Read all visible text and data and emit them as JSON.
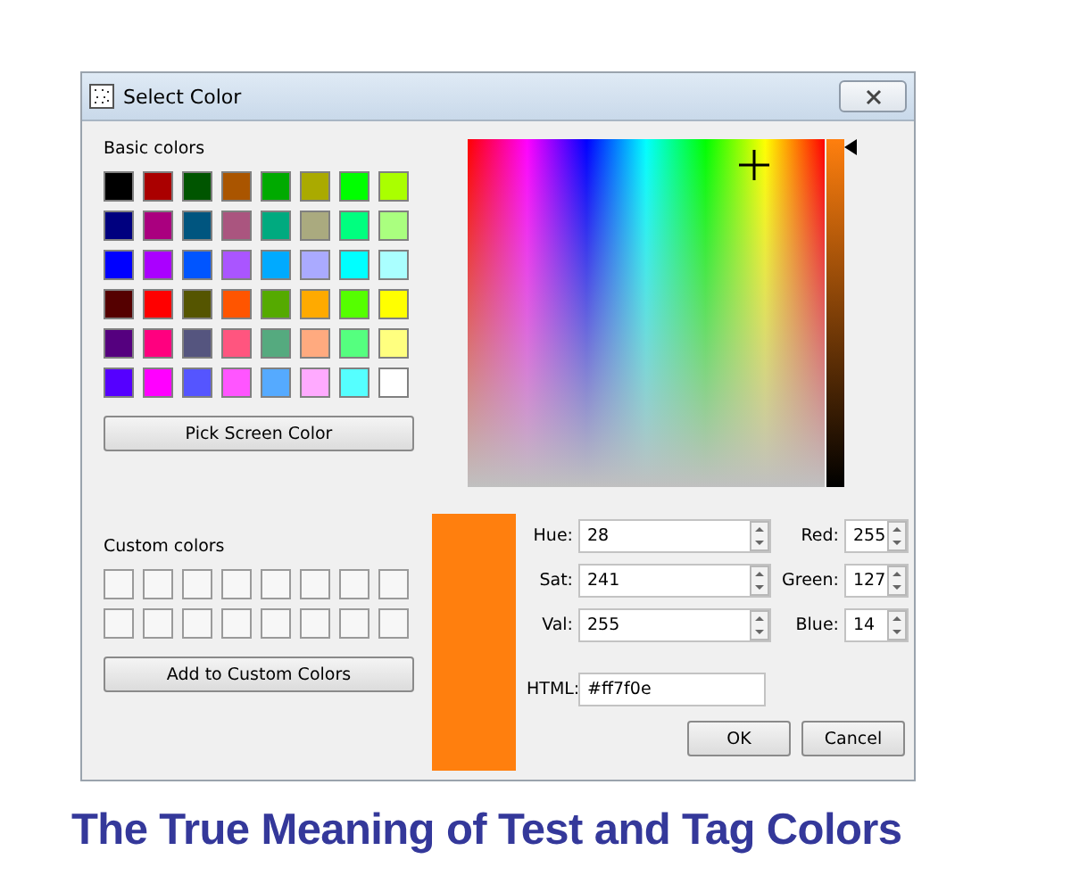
{
  "window": {
    "title": "Select Color"
  },
  "basic_colors": {
    "label": "Basic colors",
    "swatches": [
      {
        "color": "#000000"
      },
      {
        "color": "#aa0000"
      },
      {
        "color": "#005500"
      },
      {
        "color": "#aa5500"
      },
      {
        "color": "#00aa00"
      },
      {
        "color": "#aaaa00"
      },
      {
        "color": "#00ff00"
      },
      {
        "color": "#aaff00"
      },
      {
        "color": "#00007f"
      },
      {
        "color": "#aa007f"
      },
      {
        "color": "#00557f"
      },
      {
        "color": "#aa557f"
      },
      {
        "color": "#00aa7f"
      },
      {
        "color": "#aaaa7f"
      },
      {
        "color": "#00ff7f"
      },
      {
        "color": "#aaff7f"
      },
      {
        "color": "#0000ff"
      },
      {
        "color": "#aa00ff"
      },
      {
        "color": "#0055ff"
      },
      {
        "color": "#aa55ff"
      },
      {
        "color": "#00aaff"
      },
      {
        "color": "#aaaaff"
      },
      {
        "color": "#00ffff"
      },
      {
        "color": "#aaffff"
      },
      {
        "color": "#550000"
      },
      {
        "color": "#ff0000"
      },
      {
        "color": "#555500"
      },
      {
        "color": "#ff5500"
      },
      {
        "color": "#55aa00"
      },
      {
        "color": "#ffaa00"
      },
      {
        "color": "#55ff00"
      },
      {
        "color": "#ffff00"
      },
      {
        "color": "#55007f"
      },
      {
        "color": "#ff007f"
      },
      {
        "color": "#55557f"
      },
      {
        "color": "#ff557f"
      },
      {
        "color": "#55aa7f"
      },
      {
        "color": "#ffaa7f"
      },
      {
        "color": "#55ff7f"
      },
      {
        "color": "#ffff7f"
      },
      {
        "color": "#5500ff"
      },
      {
        "color": "#ff00ff"
      },
      {
        "color": "#5555ff"
      },
      {
        "color": "#ff55ff"
      },
      {
        "color": "#55aaff"
      },
      {
        "color": "#ffaaff"
      },
      {
        "color": "#55ffff"
      },
      {
        "color": "#ffffff"
      }
    ]
  },
  "pick_screen_button": "Pick Screen Color",
  "custom_colors": {
    "label": "Custom colors",
    "slots": [
      {
        "kind": "empty"
      },
      {
        "kind": "empty"
      },
      {
        "kind": "empty"
      },
      {
        "kind": "empty"
      },
      {
        "kind": "empty"
      },
      {
        "kind": "empty"
      },
      {
        "kind": "empty"
      },
      {
        "kind": "empty"
      },
      {
        "kind": "empty"
      },
      {
        "kind": "empty"
      },
      {
        "kind": "empty"
      },
      {
        "kind": "empty"
      },
      {
        "kind": "empty"
      },
      {
        "kind": "empty"
      },
      {
        "kind": "empty"
      },
      {
        "kind": "empty"
      }
    ]
  },
  "add_custom_button": "Add to Custom Colors",
  "value_slider": {
    "level": 1
  },
  "preview": {
    "color": "#ff7f0e"
  },
  "hsv_fields": [
    {
      "label": "Hue:",
      "value": "28"
    },
    {
      "label": "Sat:",
      "value": "241"
    },
    {
      "label": "Val:",
      "value": "255"
    }
  ],
  "rgb_fields": [
    {
      "label": "Red:",
      "value": "255"
    },
    {
      "label": "Green:",
      "value": "127"
    },
    {
      "label": "Blue:",
      "value": "14"
    }
  ],
  "html_field": {
    "label": "HTML:",
    "value": "#ff7f0e"
  },
  "buttons": [
    "OK",
    "Cancel"
  ],
  "caption": "The True Meaning of Test and Tag Colors"
}
